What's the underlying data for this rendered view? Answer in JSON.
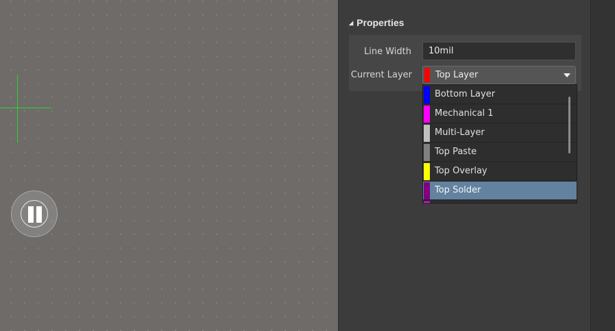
{
  "properties": {
    "title": "Properties",
    "line_width_label": "Line Width",
    "line_width_value": "10mil",
    "current_layer_label": "Current Layer",
    "current_layer_value": "Top Layer",
    "current_layer_color": "#ff0000"
  },
  "layer_dropdown": {
    "items": [
      {
        "label": "Bottom Layer",
        "color": "#0000ff"
      },
      {
        "label": "Mechanical 1",
        "color": "#ff00ff"
      },
      {
        "label": "Multi-Layer",
        "color": "#c0c0c0"
      },
      {
        "label": "Top Paste",
        "color": "#808080"
      },
      {
        "label": "Top Overlay",
        "color": "#ffff00"
      },
      {
        "label": "Top Solder",
        "color": "#800080",
        "selected": true
      },
      {
        "label": "",
        "color": "#ff00ff"
      }
    ]
  },
  "colors": {
    "canvas_background": "#6e6b68",
    "cursor": "#28d82a",
    "selection_highlight": "#62829f"
  },
  "icons": {
    "pause": "pause-icon",
    "expand": "triangle-down-icon",
    "dropdown": "chevron-down-icon"
  }
}
